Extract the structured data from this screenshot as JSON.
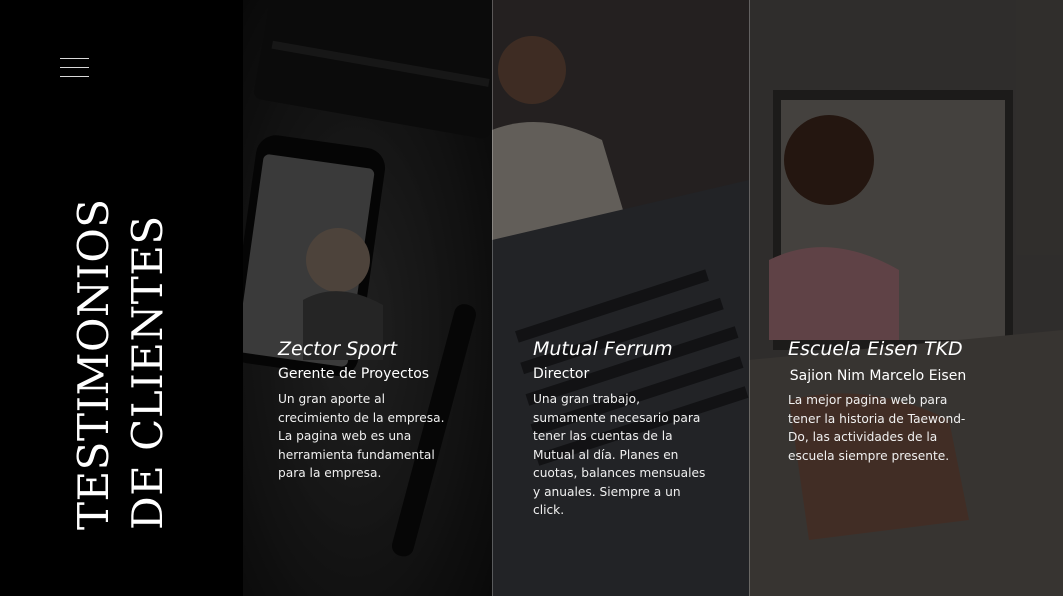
{
  "section_title": {
    "line1": "TESTIMONIOS",
    "line2": "DE CLIENTES"
  },
  "menu": {
    "icon": "hamburger-menu-icon"
  },
  "testimonials": [
    {
      "company": "Zector Sport",
      "role": "Gerente de Proyectos",
      "text": "Un gran aporte al crecimiento de la empresa. La pagina web es una herramienta fundamental para la empresa.",
      "image": "phone-on-notebook-photo"
    },
    {
      "company": "Mutual Ferrum",
      "role": "Director",
      "text": "Una gran trabajo, sumamente necesario para tener las cuentas de la Mutual al día. Planes en cuotas, balances mensuales y anuales. Siempre a un click.",
      "image": "woman-on-phone-laptop-photo"
    },
    {
      "company": "Escuela Eisen TKD",
      "role": "Sajion Nim Marcelo Eisen",
      "text": "La mejor pagina web para tener  la historia de Taewond-Do, las actividades de la escuela siempre presente.",
      "image": "smiling-woman-laptop-photo"
    }
  ],
  "colors": {
    "background": "#000000",
    "text": "#ffffff"
  }
}
